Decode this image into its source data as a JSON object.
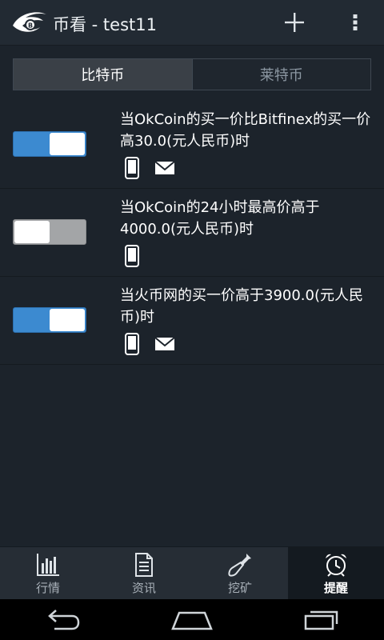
{
  "appbar": {
    "title": "币看 - test11",
    "add_icon": "plus-icon",
    "menu_icon": "overflow-menu-icon"
  },
  "tabs": [
    {
      "label": "比特币",
      "active": true
    },
    {
      "label": "莱特币",
      "active": false
    }
  ],
  "alerts": [
    {
      "enabled": true,
      "text": "当OkCoin的买一价比Bitfinex的买一价高30.0(元人民币)时",
      "notify": [
        "phone-icon",
        "mail-icon"
      ]
    },
    {
      "enabled": false,
      "text": "当OkCoin的24小时最高价高于4000.0(元人民币)时",
      "notify": [
        "phone-icon"
      ]
    },
    {
      "enabled": true,
      "text": "当火币网的买一价高于3900.0(元人民币)时",
      "notify": [
        "phone-icon",
        "mail-icon"
      ]
    }
  ],
  "bottom_nav": [
    {
      "label": "行情",
      "icon": "chart-bars-icon",
      "active": false
    },
    {
      "label": "资讯",
      "icon": "document-icon",
      "active": false
    },
    {
      "label": "挖矿",
      "icon": "shovel-icon",
      "active": false
    },
    {
      "label": "提醒",
      "icon": "alarm-clock-icon",
      "active": true
    }
  ],
  "colors": {
    "background": "#1c232b",
    "toggle_on": "#3c8ad0",
    "toggle_off": "#a3a5a7"
  }
}
